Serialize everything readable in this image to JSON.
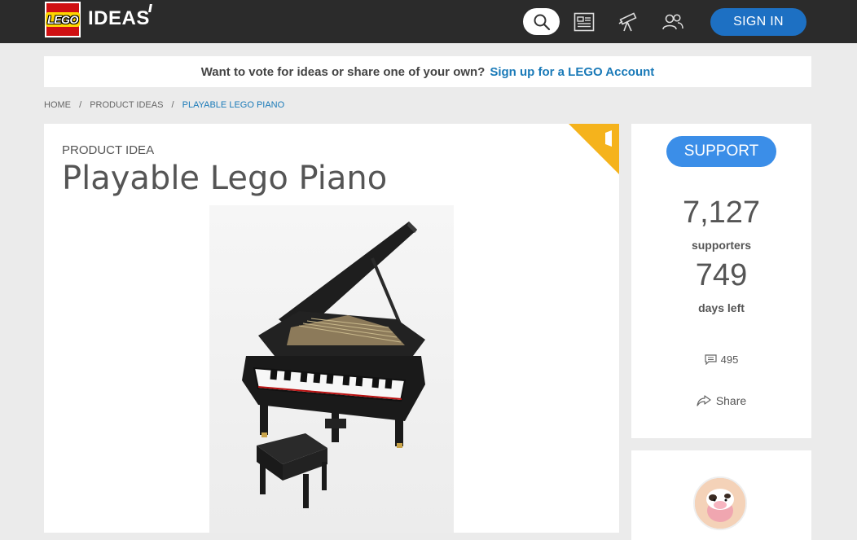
{
  "header": {
    "logo_text": "LEGO",
    "brand_text": "IDEAS",
    "signin_label": "SIGN IN",
    "icons": [
      "search-icon",
      "news-icon",
      "explore-icon",
      "community-icon"
    ]
  },
  "banner": {
    "text": "Want to vote for ideas or share one of your own?",
    "link_text": "Sign up for a LEGO Account"
  },
  "breadcrumb": {
    "items": [
      "HOME",
      "PRODUCT IDEAS",
      "PLAYABLE LEGO PIANO"
    ]
  },
  "idea": {
    "kicker": "PRODUCT IDEA",
    "title": "Playable Lego Piano",
    "image_name": "piano-photo"
  },
  "stats": {
    "support_label": "SUPPORT",
    "supporters": "7,127",
    "supporters_label": "supporters",
    "days": "749",
    "days_label": "days left",
    "comments": "495",
    "share_label": "Share"
  },
  "colors": {
    "topbar": "#2b2b2b",
    "lego_red": "#d01012",
    "signin_blue": "#1d70c3",
    "support_blue": "#3b8ee8",
    "link_blue": "#1a7ab8",
    "corner_yellow": "#f5b31c"
  }
}
